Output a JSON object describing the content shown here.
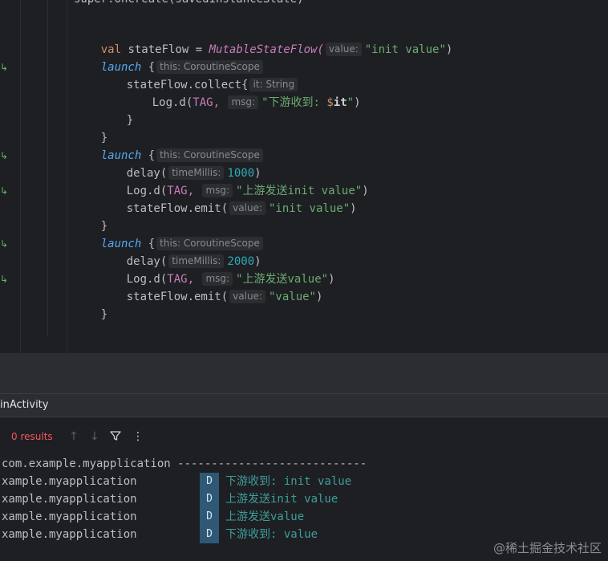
{
  "editor": {
    "top_partial": "super.onCreate(savedInstanceState)",
    "line1": {
      "kw": "val",
      "name": "stateFlow",
      "eq": "=",
      "call": "MutableStateFlow(",
      "hint": "value:",
      "str": "\"init value\"",
      "close": ")"
    },
    "line2": {
      "launch": "launch",
      "brace": "{",
      "hint": "this: CoroutineScope"
    },
    "line3": {
      "text": "stateFlow.collect{",
      "hint": "it: String"
    },
    "line4": {
      "call": "Log.d(",
      "tag": "TAG,",
      "hint": "msg:",
      "str_a": "\"下游收到: ",
      "templ": "$",
      "var": "it",
      "str_b": "\"",
      "close": ")"
    },
    "line5": {
      "text": "}"
    },
    "line6": {
      "text": "}"
    },
    "line7": {
      "launch": "launch",
      "brace": "{",
      "hint": "this: CoroutineScope"
    },
    "line8": {
      "call": "delay(",
      "hint": "timeMillis:",
      "num": "1000",
      "close": ")"
    },
    "line9": {
      "call": "Log.d(",
      "tag": "TAG,",
      "hint": "msg:",
      "str": "\"上游发送init value\"",
      "close": ")"
    },
    "line10": {
      "call": "stateFlow.emit(",
      "hint": "value:",
      "str": "\"init value\"",
      "close": ")"
    },
    "line11": {
      "text": "}"
    },
    "line12": {
      "launch": "launch",
      "brace": "{",
      "hint": "this: CoroutineScope"
    },
    "line13": {
      "call": "delay(",
      "hint": "timeMillis:",
      "num": "2000",
      "close": ")"
    },
    "line14": {
      "call": "Log.d(",
      "tag": "TAG,",
      "hint": "msg:",
      "str": "\"上游发送value\"",
      "close": ")"
    },
    "line15": {
      "call": "stateFlow.emit(",
      "hint": "value:",
      "str": "\"value\"",
      "close": ")"
    },
    "line16": {
      "text": "}"
    },
    "gutter_icon": "run-gutter-icon"
  },
  "tool_window": {
    "title": "inActivity",
    "results": "0 results",
    "icons": [
      "arrow-up-icon",
      "arrow-down-icon",
      "filter-icon",
      "more-icon"
    ]
  },
  "log": {
    "header": "com.example.myapplication ----------------------------",
    "rows": [
      {
        "pkg": "xample.myapplication",
        "level": "D",
        "msg": "下游收到: init value"
      },
      {
        "pkg": "xample.myapplication",
        "level": "D",
        "msg": "上游发送init value"
      },
      {
        "pkg": "xample.myapplication",
        "level": "D",
        "msg": "上游发送value"
      },
      {
        "pkg": "xample.myapplication",
        "level": "D",
        "msg": "下游收到: value"
      }
    ]
  },
  "watermark": "@稀土掘金技术社区",
  "colors": {
    "background": "#1e1f22",
    "panel": "#2b2d30",
    "keyword": "#cf8e6d",
    "string": "#6aab73",
    "number": "#2aacb8",
    "function": "#56a8f5",
    "log_message": "#3d9e9e",
    "log_badge": "#2f5876",
    "results_red": "#f75464"
  }
}
